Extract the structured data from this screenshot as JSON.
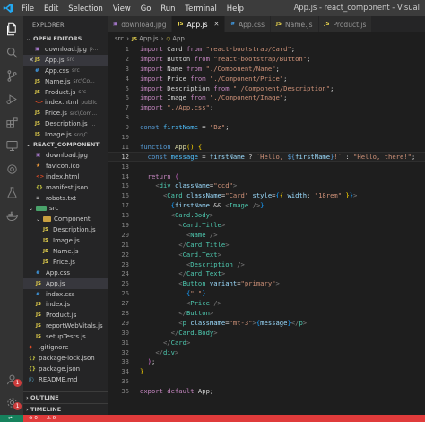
{
  "menu": [
    "File",
    "Edit",
    "Selection",
    "View",
    "Go",
    "Run",
    "Terminal",
    "Help"
  ],
  "window_title": "App.js - react_component - Visual",
  "explorer": {
    "title": "EXPLORER",
    "open_editors_label": "OPEN EDITORS",
    "open_editors": [
      {
        "name": "download.jpg",
        "desc": "p...",
        "type": "img",
        "icon": "image-icon",
        "close": false
      },
      {
        "name": "App.js",
        "desc": "src",
        "type": "js",
        "icon": "js-file-icon",
        "close": true,
        "active": true
      },
      {
        "name": "App.css",
        "desc": "src",
        "type": "css",
        "icon": "css-file-icon",
        "close": false
      },
      {
        "name": "Name.js",
        "desc": "src\\Co...",
        "type": "js",
        "icon": "js-file-icon",
        "close": false
      },
      {
        "name": "Product.js",
        "desc": "src",
        "type": "js",
        "icon": "js-file-icon",
        "close": false
      },
      {
        "name": "index.html",
        "desc": "public",
        "type": "html",
        "icon": "html-file-icon",
        "close": false
      },
      {
        "name": "Price.js",
        "desc": "src\\Com...",
        "type": "js",
        "icon": "js-file-icon",
        "close": false
      },
      {
        "name": "Description.js",
        "desc": "...",
        "type": "js",
        "icon": "js-file-icon",
        "close": false
      },
      {
        "name": "Image.js",
        "desc": "src\\C...",
        "type": "js",
        "icon": "js-file-icon",
        "close": false
      }
    ],
    "project_label": "REACT_COMPONENT",
    "tree": [
      {
        "name": "download.jpg",
        "type": "img",
        "indent": 1,
        "icon": "image-icon"
      },
      {
        "name": "favicon.ico",
        "type": "ico",
        "indent": 1,
        "icon": "favicon-icon"
      },
      {
        "name": "index.html",
        "type": "html",
        "indent": 1,
        "icon": "html-file-icon"
      },
      {
        "name": "manifest.json",
        "type": "json",
        "indent": 1,
        "icon": "json-file-icon"
      },
      {
        "name": "robots.txt",
        "type": "txt",
        "indent": 1,
        "icon": "text-file-icon"
      },
      {
        "name": "src",
        "type": "folder-src",
        "indent": 0,
        "icon": "folder-icon"
      },
      {
        "name": "Component",
        "type": "folder-comp",
        "indent": 1,
        "icon": "folder-icon"
      },
      {
        "name": "Description.js",
        "type": "js",
        "indent": 2,
        "icon": "js-file-icon"
      },
      {
        "name": "Image.js",
        "type": "js",
        "indent": 2,
        "icon": "js-file-icon"
      },
      {
        "name": "Name.js",
        "type": "js",
        "indent": 2,
        "icon": "js-file-icon"
      },
      {
        "name": "Price.js",
        "type": "js",
        "indent": 2,
        "icon": "js-file-icon"
      },
      {
        "name": "App.css",
        "type": "css",
        "indent": 1,
        "icon": "css-file-icon"
      },
      {
        "name": "App.js",
        "type": "js",
        "indent": 1,
        "icon": "js-file-icon",
        "active": true
      },
      {
        "name": "index.css",
        "type": "css",
        "indent": 1,
        "icon": "css-file-icon"
      },
      {
        "name": "index.js",
        "type": "js",
        "indent": 1,
        "icon": "js-file-icon"
      },
      {
        "name": "Product.js",
        "type": "js",
        "indent": 1,
        "icon": "js-file-icon"
      },
      {
        "name": "reportWebVitals.js",
        "type": "js",
        "indent": 1,
        "icon": "js-file-icon"
      },
      {
        "name": "setupTests.js",
        "type": "js",
        "indent": 1,
        "icon": "js-file-icon"
      },
      {
        "name": ".gitignore",
        "type": "git",
        "indent": 0,
        "icon": "git-icon"
      },
      {
        "name": "package-lock.json",
        "type": "json",
        "indent": 0,
        "icon": "json-file-icon"
      },
      {
        "name": "package.json",
        "type": "json",
        "indent": 0,
        "icon": "json-file-icon"
      },
      {
        "name": "README.md",
        "type": "md",
        "indent": 0,
        "icon": "markdown-icon"
      }
    ],
    "outline_label": "OUTLINE",
    "timeline_label": "TIMELINE"
  },
  "tabs": [
    {
      "label": "download.jpg",
      "type": "img",
      "active": false
    },
    {
      "label": "App.js",
      "type": "js",
      "active": true
    },
    {
      "label": "App.css",
      "type": "css",
      "active": false
    },
    {
      "label": "Name.js",
      "type": "js",
      "active": false
    },
    {
      "label": "Product.js",
      "type": "js",
      "active": false
    }
  ],
  "breadcrumb": [
    "src",
    "App.js",
    "App"
  ],
  "current_line": 12,
  "code_lines": [
    [
      [
        "kw",
        "import "
      ],
      [
        "txt",
        "Card "
      ],
      [
        "kw",
        "from "
      ],
      [
        "str",
        "\"react-bootstrap/Card\""
      ],
      [
        "txt",
        ";"
      ]
    ],
    [
      [
        "kw",
        "import "
      ],
      [
        "txt",
        "Button "
      ],
      [
        "kw",
        "from "
      ],
      [
        "str",
        "\"react-bootstrap/Button\""
      ],
      [
        "txt",
        ";"
      ]
    ],
    [
      [
        "kw",
        "import "
      ],
      [
        "txt",
        "Name "
      ],
      [
        "kw",
        "from "
      ],
      [
        "str",
        "\"./Component/Name\""
      ],
      [
        "txt",
        ";"
      ]
    ],
    [
      [
        "kw",
        "import "
      ],
      [
        "txt",
        "Price "
      ],
      [
        "kw",
        "from "
      ],
      [
        "str",
        "\"./Component/Price\""
      ],
      [
        "txt",
        ";"
      ]
    ],
    [
      [
        "kw",
        "import "
      ],
      [
        "txt",
        "Description "
      ],
      [
        "kw",
        "from "
      ],
      [
        "str",
        "\"./Component/Description\""
      ],
      [
        "txt",
        ";"
      ]
    ],
    [
      [
        "kw",
        "import "
      ],
      [
        "txt",
        "Image "
      ],
      [
        "kw",
        "from "
      ],
      [
        "str",
        "\"./Component/Image\""
      ],
      [
        "txt",
        ";"
      ]
    ],
    [
      [
        "kw",
        "import "
      ],
      [
        "str",
        "\"./App.css\""
      ],
      [
        "txt",
        ";"
      ]
    ],
    [],
    [
      [
        "decl",
        "const "
      ],
      [
        "cst",
        "firstName"
      ],
      [
        "txt",
        " = "
      ],
      [
        "str",
        "\"Bz\""
      ],
      [
        "txt",
        ";"
      ]
    ],
    [],
    [
      [
        "decl",
        "function "
      ],
      [
        "fn",
        "App"
      ],
      [
        "br1",
        "()"
      ],
      [
        "txt",
        " "
      ],
      [
        "br1",
        "{"
      ]
    ],
    [
      [
        "txt",
        "  "
      ],
      [
        "decl",
        "const "
      ],
      [
        "cst",
        "message"
      ],
      [
        "txt",
        " = "
      ],
      [
        "var",
        "firstName"
      ],
      [
        "txt",
        " ? "
      ],
      [
        "str",
        "`Hello, "
      ],
      [
        "decl",
        "${"
      ],
      [
        "var",
        "firstName"
      ],
      [
        "decl",
        "}"
      ],
      [
        "str",
        "!`"
      ],
      [
        "txt",
        " : "
      ],
      [
        "str",
        "\"Hello, there!\""
      ],
      [
        "txt",
        ";"
      ]
    ],
    [],
    [
      [
        "txt",
        "  "
      ],
      [
        "kw",
        "return "
      ],
      [
        "br2",
        "("
      ]
    ],
    [
      [
        "txt",
        "    "
      ],
      [
        "br",
        "<"
      ],
      [
        "tag",
        "div"
      ],
      [
        "txt",
        " "
      ],
      [
        "var",
        "className"
      ],
      [
        "txt",
        "="
      ],
      [
        "str",
        "\"ccd\""
      ],
      [
        "br",
        ">"
      ]
    ],
    [
      [
        "txt",
        "      "
      ],
      [
        "br",
        "<"
      ],
      [
        "tag",
        "Card"
      ],
      [
        "txt",
        " "
      ],
      [
        "var",
        "className"
      ],
      [
        "txt",
        "="
      ],
      [
        "str",
        "\"Card\""
      ],
      [
        "txt",
        " "
      ],
      [
        "var",
        "style"
      ],
      [
        "txt",
        "="
      ],
      [
        "br3",
        "{"
      ],
      [
        "br1",
        "{"
      ],
      [
        "txt",
        " "
      ],
      [
        "var",
        "width"
      ],
      [
        "txt",
        ": "
      ],
      [
        "str",
        "\"18rem\""
      ],
      [
        "txt",
        " "
      ],
      [
        "br1",
        "}"
      ],
      [
        "br3",
        "}"
      ],
      [
        "br",
        ">"
      ]
    ],
    [
      [
        "txt",
        "        "
      ],
      [
        "br3",
        "{"
      ],
      [
        "var",
        "firstName"
      ],
      [
        "txt",
        " && "
      ],
      [
        "br",
        "<"
      ],
      [
        "tag",
        "Image"
      ],
      [
        "txt",
        " "
      ],
      [
        "br",
        "/>"
      ],
      [
        "br3",
        "}"
      ]
    ],
    [
      [
        "txt",
        "        "
      ],
      [
        "br",
        "<"
      ],
      [
        "tag",
        "Card.Body"
      ],
      [
        "br",
        ">"
      ]
    ],
    [
      [
        "txt",
        "          "
      ],
      [
        "br",
        "<"
      ],
      [
        "tag",
        "Card.Title"
      ],
      [
        "br",
        ">"
      ]
    ],
    [
      [
        "txt",
        "            "
      ],
      [
        "br",
        "<"
      ],
      [
        "tag",
        "Name"
      ],
      [
        "txt",
        " "
      ],
      [
        "br",
        "/>"
      ]
    ],
    [
      [
        "txt",
        "          "
      ],
      [
        "br",
        "</"
      ],
      [
        "tag",
        "Card.Title"
      ],
      [
        "br",
        ">"
      ]
    ],
    [
      [
        "txt",
        "          "
      ],
      [
        "br",
        "<"
      ],
      [
        "tag",
        "Card.Text"
      ],
      [
        "br",
        ">"
      ]
    ],
    [
      [
        "txt",
        "            "
      ],
      [
        "br",
        "<"
      ],
      [
        "tag",
        "Description"
      ],
      [
        "txt",
        " "
      ],
      [
        "br",
        "/>"
      ]
    ],
    [
      [
        "txt",
        "          "
      ],
      [
        "br",
        "</"
      ],
      [
        "tag",
        "Card.Text"
      ],
      [
        "br",
        ">"
      ]
    ],
    [
      [
        "txt",
        "          "
      ],
      [
        "br",
        "<"
      ],
      [
        "tag",
        "Button"
      ],
      [
        "txt",
        " "
      ],
      [
        "var",
        "variant"
      ],
      [
        "txt",
        "="
      ],
      [
        "str",
        "\"primary\""
      ],
      [
        "br",
        ">"
      ]
    ],
    [
      [
        "txt",
        "            "
      ],
      [
        "br3",
        "{"
      ],
      [
        "str",
        "\" \""
      ],
      [
        "br3",
        "}"
      ]
    ],
    [
      [
        "txt",
        "            "
      ],
      [
        "br",
        "<"
      ],
      [
        "tag",
        "Price"
      ],
      [
        "txt",
        " "
      ],
      [
        "br",
        "/>"
      ]
    ],
    [
      [
        "txt",
        "          "
      ],
      [
        "br",
        "</"
      ],
      [
        "tag",
        "Button"
      ],
      [
        "br",
        ">"
      ]
    ],
    [
      [
        "txt",
        "          "
      ],
      [
        "br",
        "<"
      ],
      [
        "tag",
        "p"
      ],
      [
        "txt",
        " "
      ],
      [
        "var",
        "className"
      ],
      [
        "txt",
        "="
      ],
      [
        "str",
        "\"mt-3\""
      ],
      [
        "br",
        ">"
      ],
      [
        "br3",
        "{"
      ],
      [
        "var",
        "message"
      ],
      [
        "br3",
        "}"
      ],
      [
        "br",
        "</"
      ],
      [
        "tag",
        "p"
      ],
      [
        "br",
        ">"
      ]
    ],
    [
      [
        "txt",
        "        "
      ],
      [
        "br",
        "</"
      ],
      [
        "tag",
        "Card.Body"
      ],
      [
        "br",
        ">"
      ]
    ],
    [
      [
        "txt",
        "      "
      ],
      [
        "br",
        "</"
      ],
      [
        "tag",
        "Card"
      ],
      [
        "br",
        ">"
      ]
    ],
    [
      [
        "txt",
        "    "
      ],
      [
        "br",
        "</"
      ],
      [
        "tag",
        "div"
      ],
      [
        "br",
        ">"
      ]
    ],
    [
      [
        "txt",
        "  "
      ],
      [
        "br2",
        ")"
      ],
      [
        "txt",
        ";"
      ]
    ],
    [
      [
        "br1",
        "}"
      ]
    ],
    [],
    [
      [
        "kw",
        "export "
      ],
      [
        "kw",
        "default "
      ],
      [
        "txt",
        "App;"
      ]
    ]
  ],
  "colors": {
    "status_bar": "#e03b3b",
    "remote": "#16825d",
    "accent_js": "#e8d44d"
  },
  "status": {
    "remote_label": "⇌",
    "errors": "⊗ 0",
    "warnings": "⚠ 0"
  },
  "activity_badge": "1"
}
